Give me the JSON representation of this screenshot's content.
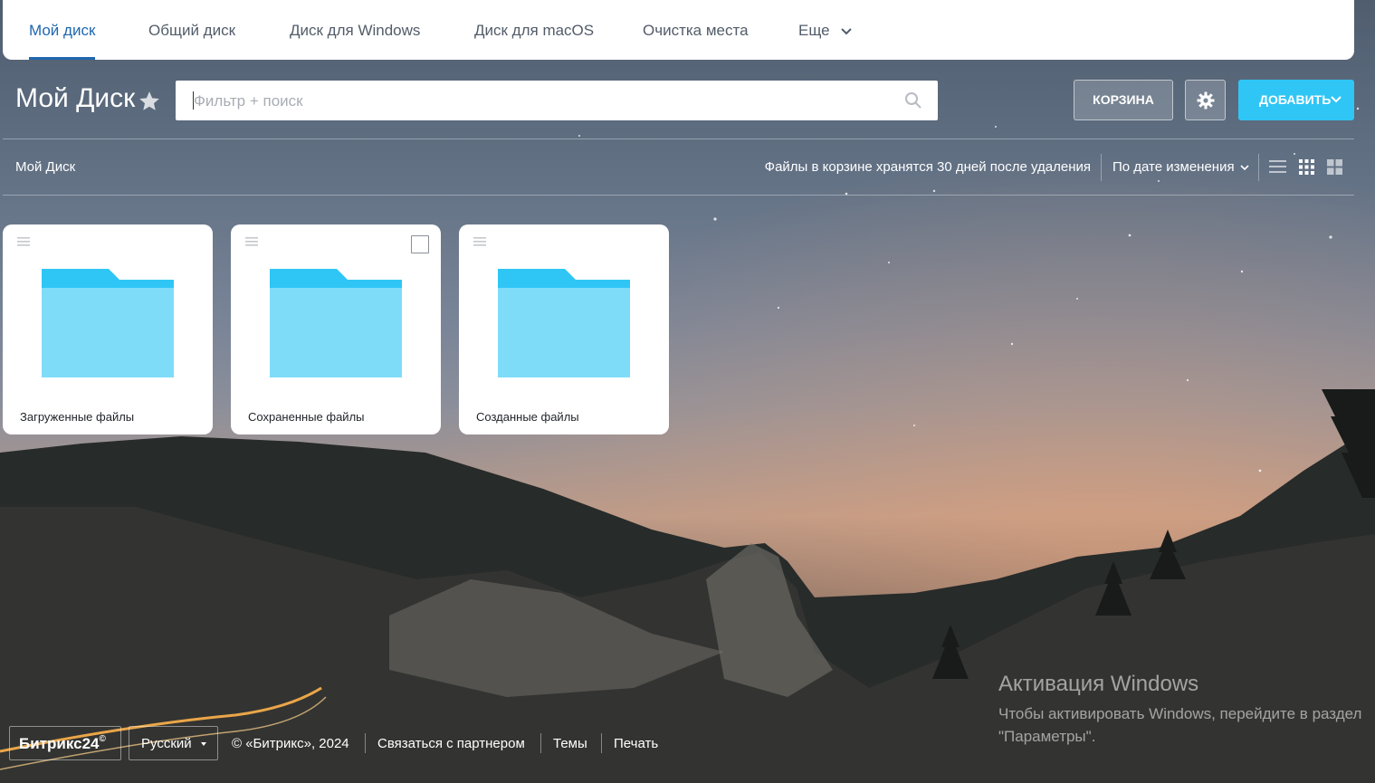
{
  "nav": {
    "tabs": [
      {
        "label": "Мой диск",
        "active": true
      },
      {
        "label": "Общий диск"
      },
      {
        "label": "Диск для Windows"
      },
      {
        "label": "Диск для macOS"
      },
      {
        "label": "Очистка места"
      },
      {
        "label": "Еще"
      }
    ]
  },
  "header": {
    "title": "Мой Диск",
    "search_placeholder": "Фильтр + поиск",
    "trash_button": "КОРЗИНА",
    "add_button": "ДОБАВИТЬ"
  },
  "toolbar": {
    "breadcrumb": "Мой Диск",
    "trash_note": "Файлы в корзине хранятся 30 дней после удаления",
    "sort_label": "По дате изменения"
  },
  "folders": [
    {
      "name": "Загруженные файлы"
    },
    {
      "name": "Сохраненные файлы"
    },
    {
      "name": "Созданные файлы"
    }
  ],
  "windows_activation": {
    "title": "Активация Windows",
    "line1": "Чтобы активировать Windows, перейдите в раздел",
    "line2": "\"Параметры\"."
  },
  "footer": {
    "logo": "Битрикс24",
    "language": "Русский",
    "copyright": "© «Битрикс», 2024",
    "links": [
      "Связаться с партнером",
      "Темы",
      "Печать"
    ]
  },
  "colors": {
    "accent": "#2067b0",
    "add_button": "#2fc6f6",
    "folder_tab": "#2fc6f6",
    "folder_body": "#7fdcf8"
  },
  "icons": [
    "star-icon",
    "search-icon",
    "gear-icon",
    "chevron-down-icon",
    "list-view-icon",
    "grid-view-icon",
    "tile-view-icon",
    "drag-menu-icon",
    "folder-icon"
  ]
}
